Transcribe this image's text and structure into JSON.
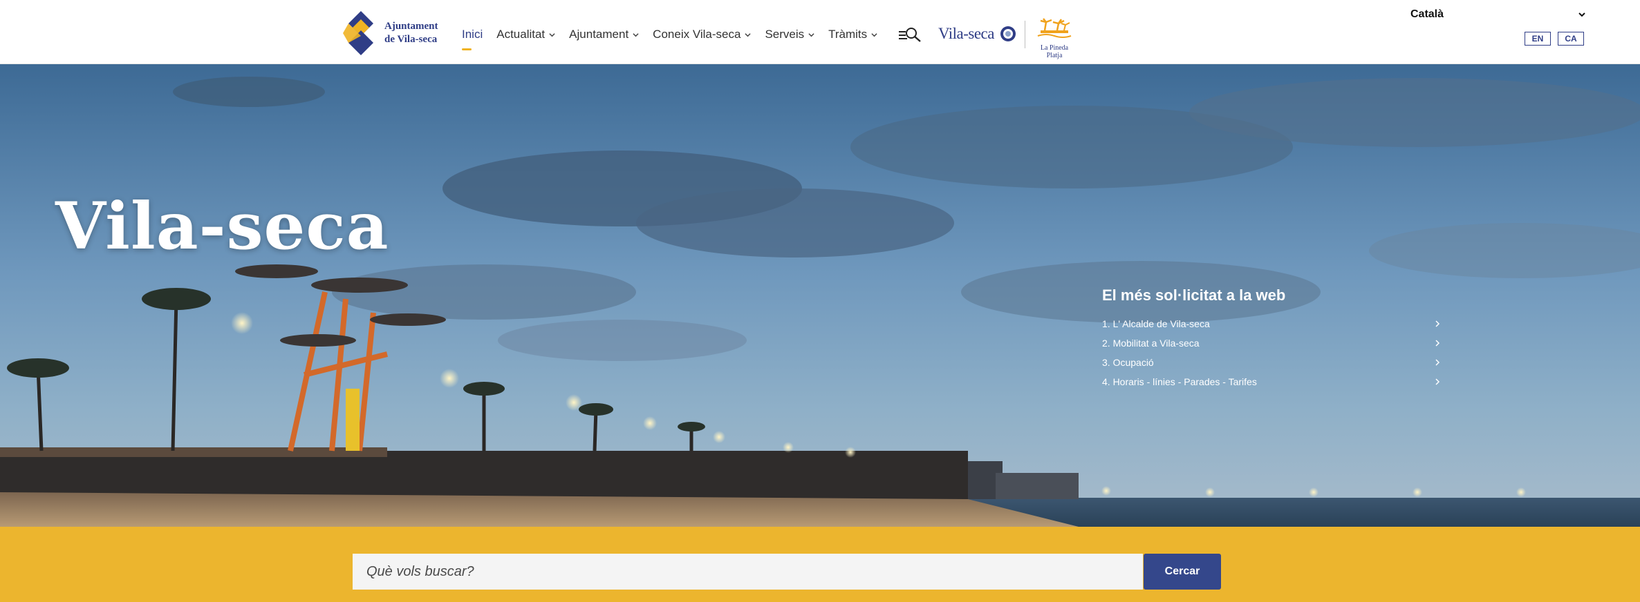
{
  "header": {
    "logo_line1": "Ajuntament",
    "logo_line2": "de Vila-seca",
    "nav": [
      {
        "label": "Inici",
        "active": true
      },
      {
        "label": "Actualitat",
        "dropdown": true
      },
      {
        "label": "Ajuntament",
        "dropdown": true
      },
      {
        "label": "Coneix Vila-seca",
        "dropdown": true
      },
      {
        "label": "Serveis",
        "dropdown": true
      },
      {
        "label": "Tràmits",
        "dropdown": true
      }
    ],
    "search_icon": "search-icon",
    "brand_vila": "Vila-seca",
    "brand_pineda": "La Pineda Platja",
    "language_selected": "Català",
    "lang_buttons": [
      "EN",
      "CA"
    ]
  },
  "hero": {
    "title": "Vila-seca",
    "popular_title": "El més sol·licitat a la web",
    "popular_items": [
      "1. L' Alcalde de Vila-seca",
      "2. Mobilitat a Vila-seca",
      "3. Ocupació",
      "4. Horaris - línies - Parades - Tarifes"
    ]
  },
  "search": {
    "placeholder": "Què vols buscar?",
    "button": "Cercar"
  },
  "colors": {
    "brand_blue": "#2f3d86",
    "accent_yellow": "#ecb52e",
    "button_blue": "#34478b"
  }
}
